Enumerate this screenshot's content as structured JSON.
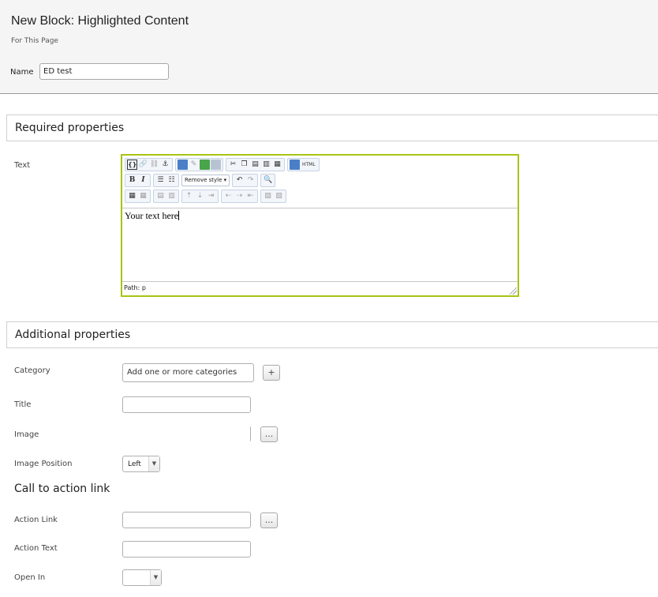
{
  "header": {
    "title": "New Block: Highlighted Content",
    "subtitle": "For This Page",
    "name_label": "Name",
    "name_value": "ED test"
  },
  "required": {
    "heading": "Required properties",
    "text_label": "Text",
    "editor": {
      "content": "Your text here",
      "path": "Path: p",
      "style_select": "Remove style",
      "html_button": "HTML"
    }
  },
  "additional": {
    "heading": "Additional properties",
    "category_label": "Category",
    "category_placeholder": "Add one or more categories",
    "add_button": "+",
    "title_label": "Title",
    "image_label": "Image",
    "browse_button": "...",
    "image_position_label": "Image Position",
    "image_position_value": "Left"
  },
  "cta": {
    "heading": "Call to action link",
    "action_link_label": "Action Link",
    "browse_button": "...",
    "action_text_label": "Action Text",
    "open_in_label": "Open In",
    "open_in_value": ""
  },
  "colors": {
    "editor_border": "#a8c414",
    "header_bg": "#f5f5f5"
  }
}
